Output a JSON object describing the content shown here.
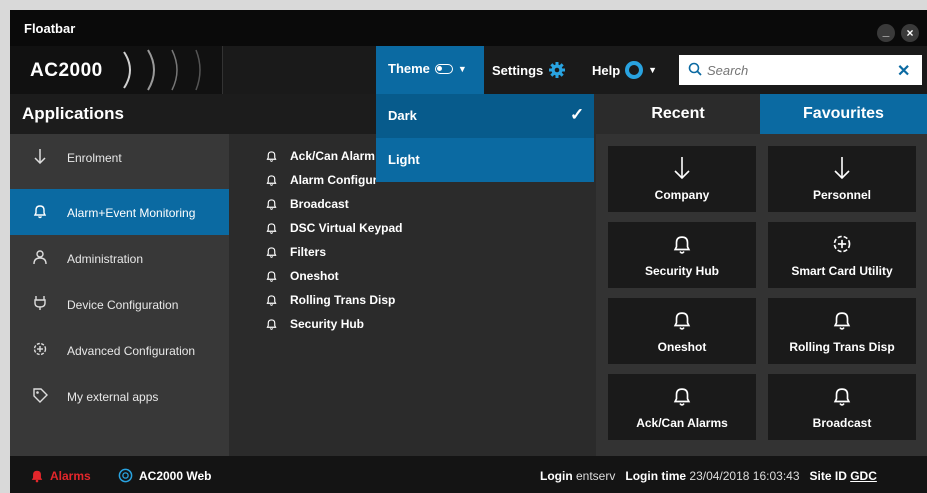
{
  "window": {
    "title": "Floatbar",
    "minimize": "_",
    "close": "×"
  },
  "header": {
    "brand": "AC2000",
    "theme_label": "Theme",
    "settings_label": "Settings",
    "help_label": "Help",
    "search": {
      "placeholder": "Search",
      "value": ""
    }
  },
  "theme_menu": {
    "items": [
      {
        "label": "Dark",
        "checked": true
      },
      {
        "label": "Light",
        "checked": false
      }
    ],
    "check_glyph": "✓"
  },
  "applications": {
    "title": "Applications",
    "categories": [
      {
        "label": "Enrolment",
        "icon": "arrow-down-icon",
        "active": false
      },
      {
        "label": "Alarm+Event Monitoring",
        "icon": "bell-icon",
        "active": true
      },
      {
        "label": "Administration",
        "icon": "user-icon",
        "active": false
      },
      {
        "label": "Device Configuration",
        "icon": "plug-icon",
        "active": false
      },
      {
        "label": "Advanced Configuration",
        "icon": "gear-plus-icon",
        "active": false
      },
      {
        "label": "My external apps",
        "icon": "tag-icon",
        "active": false
      }
    ],
    "apps": [
      "Ack/Can Alarm",
      "Alarm Configur",
      "Broadcast",
      "DSC Virtual Keypad",
      "Filters",
      "Oneshot",
      "Rolling Trans Disp",
      "Security Hub"
    ]
  },
  "right_panel": {
    "tabs": {
      "recent": "Recent",
      "favourites": "Favourites"
    },
    "tiles": [
      {
        "label": "Company",
        "icon": "arrow-down-icon"
      },
      {
        "label": "Personnel",
        "icon": "arrow-down-icon"
      },
      {
        "label": "Security Hub",
        "icon": "bell-icon"
      },
      {
        "label": "Smart Card Utility",
        "icon": "gear-plus-icon"
      },
      {
        "label": "Oneshot",
        "icon": "bell-icon"
      },
      {
        "label": "Rolling Trans Disp",
        "icon": "bell-icon"
      },
      {
        "label": "Ack/Can Alarms",
        "icon": "bell-icon"
      },
      {
        "label": "Broadcast",
        "icon": "bell-icon"
      }
    ]
  },
  "status": {
    "alarms_label": "Alarms",
    "web_label": "AC2000 Web",
    "login_label": "Login",
    "login_user": "entserv",
    "login_time_label": "Login time",
    "login_time": "23/04/2018 16:03:43",
    "site_label": "Site ID",
    "site_id": "GDC"
  },
  "colors": {
    "accent": "#0b6aa2",
    "alarm": "#e4262b",
    "background": "#2b2b2b"
  }
}
